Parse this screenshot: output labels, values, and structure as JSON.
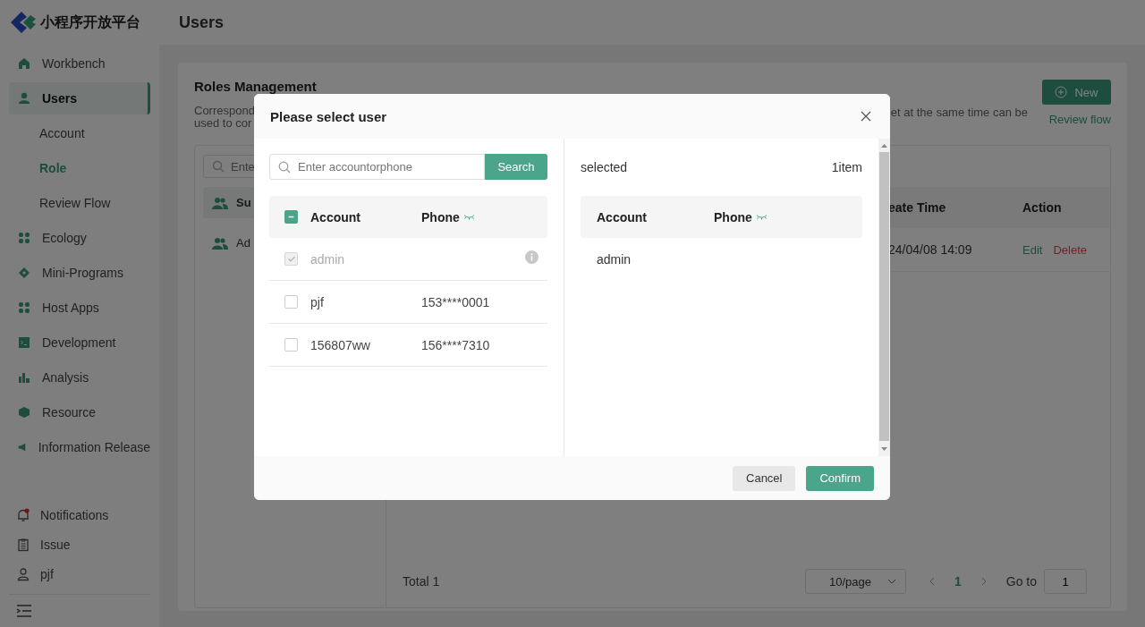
{
  "logo": {
    "text": "小程序开放平台"
  },
  "sidebar": {
    "items": [
      {
        "label": "Workbench",
        "selected": false
      },
      {
        "label": "Users",
        "selected": true,
        "children": [
          {
            "label": "Account",
            "selected": false
          },
          {
            "label": "Role",
            "selected": true
          },
          {
            "label": "Review Flow",
            "selected": false
          }
        ]
      },
      {
        "label": "Ecology",
        "selected": false
      },
      {
        "label": "Mini-Programs",
        "selected": false
      },
      {
        "label": "Host Apps",
        "selected": false
      },
      {
        "label": "Development",
        "selected": false
      },
      {
        "label": "Analysis",
        "selected": false
      },
      {
        "label": "Resource",
        "selected": false
      },
      {
        "label": "Information Release",
        "selected": false
      }
    ],
    "bottom_items": [
      {
        "label": "Notifications",
        "unread": true
      },
      {
        "label": "Issue"
      },
      {
        "label": "pjf"
      }
    ]
  },
  "page_title": "Users",
  "card": {
    "title": "Roles Management",
    "description_left_lines": [
      "Correspond",
      "used to cor"
    ],
    "description_right": "et at the same time can be",
    "new_button": "New",
    "review_link": "Review flow",
    "role_search": {
      "placeholder": "Ente"
    },
    "roles": [
      {
        "label": "Su",
        "selected": true
      },
      {
        "label": "Ad",
        "selected": false
      }
    ],
    "table": {
      "columns": [
        "eate Time",
        "Action"
      ],
      "rows": [
        {
          "create_time": "24/04/08 14:09",
          "actions": [
            "Edit",
            "Delete"
          ]
        }
      ]
    },
    "pagination": {
      "total": "Total 1",
      "page_size": "10/page",
      "pages": [
        {
          "label": "1",
          "selected": true
        }
      ],
      "goto_label": "Go to",
      "goto_value": "1"
    }
  },
  "dialog": {
    "title": "Please select user",
    "search": {
      "placeholder": "Enter accountorphone",
      "button": "Search"
    },
    "left_table": {
      "select_all": {
        "indeterminate": true
      },
      "columns": [
        "Account",
        "Phone"
      ],
      "rows": [
        {
          "account": "admin",
          "phone": "",
          "checked": true,
          "disabled": true
        },
        {
          "account": "pjf",
          "phone": "153****0001",
          "checked": false,
          "disabled": false
        },
        {
          "account": "156807ww",
          "phone": "156****7310",
          "checked": false,
          "disabled": false
        }
      ]
    },
    "selected_label": "selected",
    "selected_count": "1item",
    "right_table": {
      "columns": [
        "Account",
        "Phone"
      ],
      "rows": [
        {
          "account": "admin",
          "phone": ""
        }
      ]
    },
    "buttons": [
      "Cancel",
      "Confirm"
    ]
  }
}
